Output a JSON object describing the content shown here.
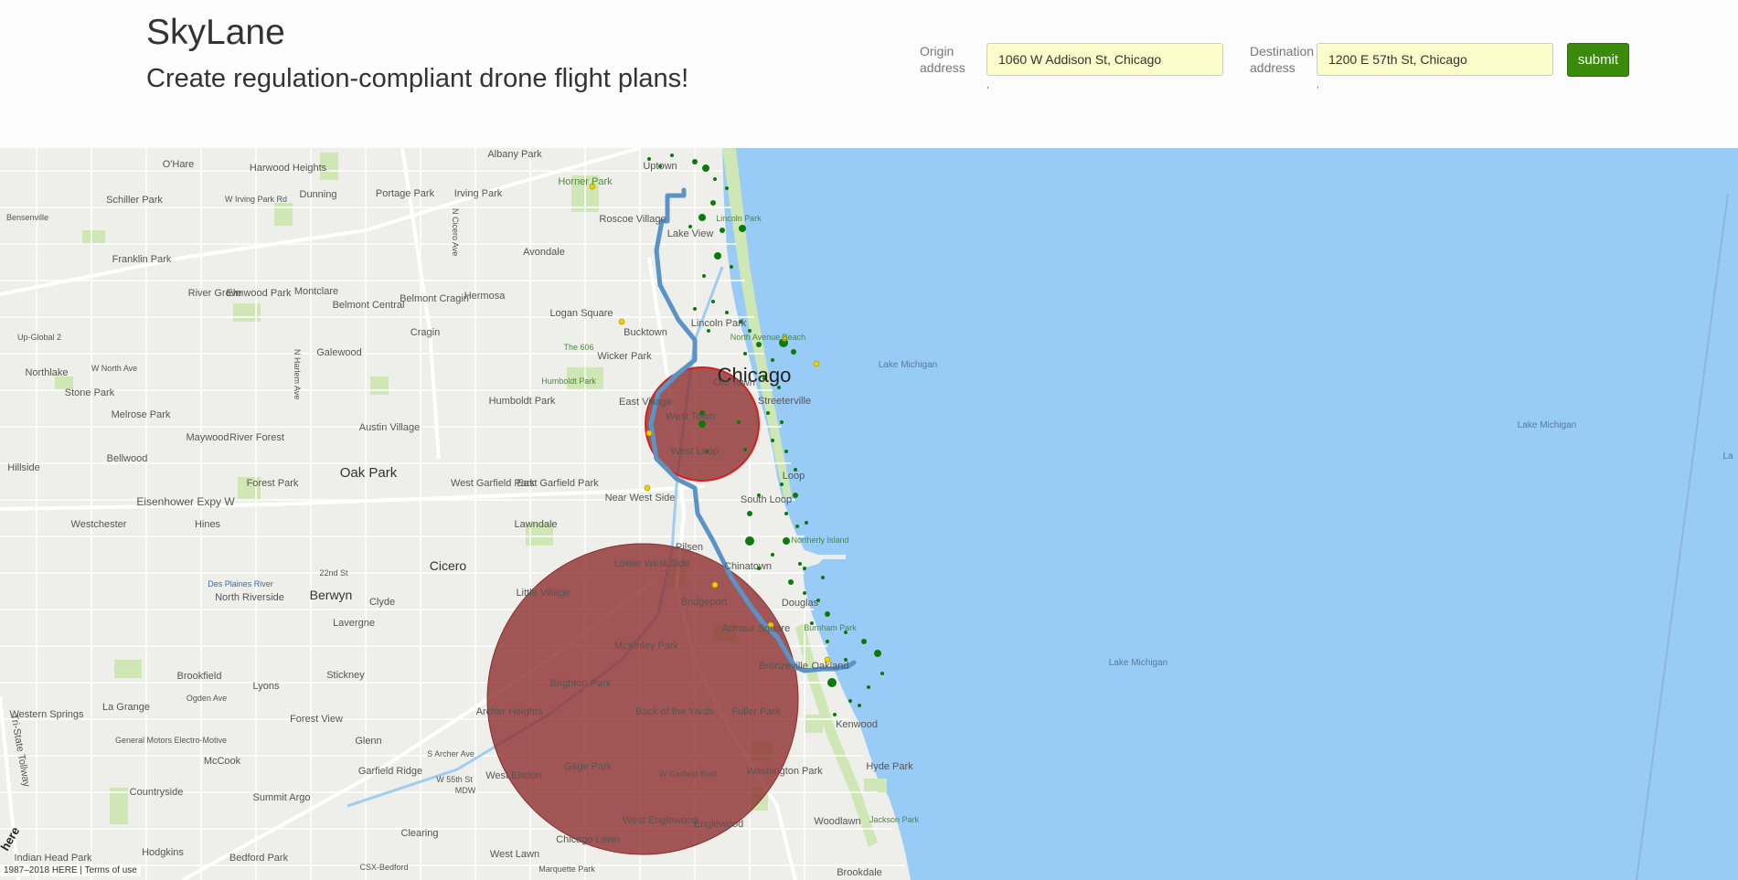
{
  "header": {
    "brand": "SkyLane",
    "tagline": "Create regulation-compliant drone flight plans!"
  },
  "form": {
    "origin_label": "Origin address",
    "origin_value": "1060 W Addison St, Chicago",
    "destination_label": "Destination address",
    "destination_value": "1200 E 57th St, Chicago",
    "submit_label": "submit"
  },
  "map": {
    "attribution": "1987–2018 HERE | Terms of use",
    "brand_watermark": "here",
    "colors": {
      "water": "#99cbf7",
      "land": "#eeefea",
      "park": "#cfe6b5",
      "route": "#5b93c7",
      "no_fly_zone": "#8c2a2a",
      "no_fly_border": "#d81d1d",
      "poi_green": "#0b7a0b",
      "poi_yellow": "#f0d000"
    },
    "places": {
      "chicago": "Chicago",
      "ohare": "O'Hare",
      "harwood": "Harwood Heights",
      "schiller": "Schiller Park",
      "irving": "W Irving Park Rd",
      "dunning": "Dunning",
      "portage": "Portage Park",
      "irving_park": "Irving Park",
      "albany": "Albany Park",
      "uptown": "Uptown",
      "horner": "Horner Park",
      "roscoe": "Roscoe Village",
      "lakeview": "Lake View",
      "lincoln_park": "Lincoln Park",
      "avondale": "Avondale",
      "bensenville": "Bensenville",
      "franklin": "Franklin Park",
      "river_grove": "River Grove",
      "elmwood": "Elmwood Park",
      "montclare": "Montclare",
      "belmont_central": "Belmont Central",
      "belmont_cragin": "Belmont Cragin",
      "hermosa": "Hermosa",
      "logan": "Logan Square",
      "cragin": "Cragin",
      "bucktown": "Bucktown",
      "north_ave_beach": "North Avenue Beach",
      "galewood": "Galewood",
      "north_ave": "W North Ave",
      "northlake": "Northlake",
      "stone_park": "Stone Park",
      "melrose": "Melrose Park",
      "humboldt": "Humboldt Park",
      "wicker": "Wicker Park",
      "the606": "The 606",
      "humboldt_park2": "Humboldt Park",
      "old_town": "Old Town",
      "streeterville": "Streeterville",
      "east_village": "East Village",
      "west_town": "West Town",
      "lake_michigan": "Lake Michigan",
      "bellwood": "Bellwood",
      "maywood": "Maywood",
      "river_forest": "River Forest",
      "austin": "Austin Village",
      "oak_park": "Oak Park",
      "west_garfield": "West Garfield Park",
      "east_garfield": "East Garfield Park",
      "near_west": "Near West Side",
      "west_loop": "West Loop",
      "loop": "Loop",
      "south_loop": "South Loop",
      "hillside": "Hillside",
      "forest_park": "Forest Park",
      "eisenhower": "Eisenhower Expy W",
      "westchester": "Westchester",
      "hines": "Hines",
      "lawndale": "Lawndale",
      "pilsen": "Pilsen",
      "northerly": "Northerly Island",
      "lower_west": "Lower West Side",
      "chinatown": "Chinatown",
      "cicero": "Cicero",
      "berwyn": "Berwyn",
      "north_riverside": "North Riverside",
      "des_plaines": "Des Plaines River",
      "22nd": "22nd St",
      "clyde": "Clyde",
      "little_village": "Little Village",
      "bridgeport": "Bridgeport",
      "douglas": "Douglas",
      "armour": "Armour Square",
      "burnham": "Burnham Park",
      "lavergne": "Lavergne",
      "mckinley": "McKinley Park",
      "bronzeville": "Bronzeville",
      "oakland": "Oakland",
      "brookfield": "Brookfield",
      "stickney": "Stickney",
      "lyons": "Lyons",
      "ogden": "Ogden Ave",
      "brighton": "Brighton Park",
      "back_yards": "Back of the Yards",
      "western_springs": "Western Springs",
      "la_grange": "La Grange",
      "archer": "Archer Heights",
      "forest_view": "Forest View",
      "fuller": "Fuller Park",
      "kenwood": "Kenwood",
      "glenn": "Glenn",
      "general_motors": "General Motors Electro-Motive",
      "mccook": "McCook",
      "garfield_ridge": "Garfield Ridge",
      "gage_park": "Gage Park",
      "west_elsdon": "West Elsdon",
      "washington_park": "Washington Park",
      "hyde_park": "Hyde Park",
      "countryside": "Countryside",
      "summit": "Summit Argo",
      "clearing": "Clearing",
      "west_englewood": "West Englewood",
      "englewood": "Englewood",
      "chicago_lawn": "Chicago Lawn",
      "woodlawn": "Woodlawn",
      "jackson": "Jackson Park",
      "indian_head": "Indian Head Park",
      "hodgkins": "Hodgkins",
      "bedford": "Bedford Park",
      "west_lawn": "West Lawn",
      "marquette": "Marquette Park",
      "brookdale": "Brookdale",
      "csx": "CSX-Bedford",
      "tri_state": "Tri-State Tollway",
      "up_global": "Up-Global 2",
      "mdw": "MDW",
      "archer_ave": "S Archer Ave",
      "55th": "W 55th St",
      "garfield_blvd": "W Garfield Blvd",
      "cicero_ave": "N Cicero Ave",
      "harlem": "N Harlem Ave",
      "ogden2": "Ogden Ave",
      "lake_michigan2": "Lake Michigan",
      "lake_michigan3": "Lake Michigan",
      "lake_michigan4": "La"
    }
  }
}
